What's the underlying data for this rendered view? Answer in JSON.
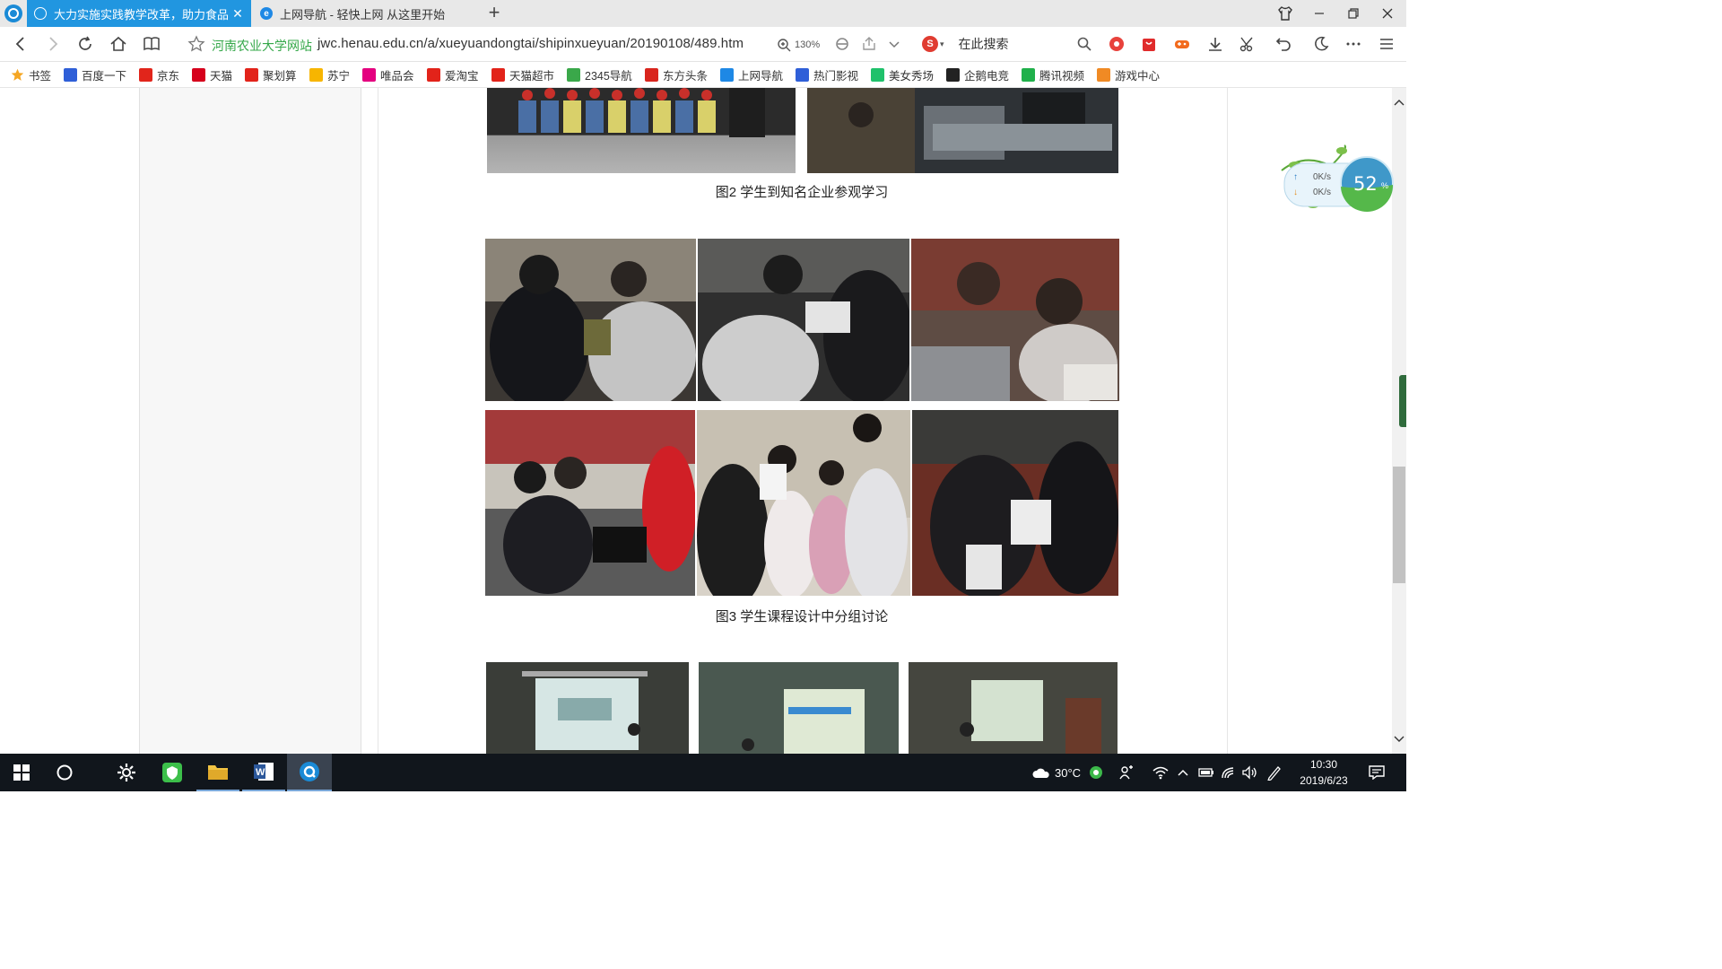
{
  "tabs": [
    {
      "title": "大力实施实践教学改革，助力食品新",
      "active": true
    },
    {
      "title": "上网导航 - 轻快上网 从这里开始",
      "active": false
    }
  ],
  "navbar": {
    "site_name": "河南农业大学网站",
    "url": "jwc.henau.edu.cn/a/xueyuandongtai/shipinxueyuan/20190108/489.htm",
    "zoom": "130%",
    "search_placeholder": "在此搜索"
  },
  "bookmarks": [
    {
      "label": "书签",
      "icon": "star-icon",
      "color": "#f5a623"
    },
    {
      "label": "百度一下",
      "icon": "baidu-paw-icon",
      "color": "#2f5fd8"
    },
    {
      "label": "京东",
      "icon": "jd-icon",
      "color": "#e1251b"
    },
    {
      "label": "天猫",
      "icon": "tmall-icon",
      "color": "#d6001c"
    },
    {
      "label": "聚划算",
      "icon": "juhuasuan-icon",
      "color": "#e2231a"
    },
    {
      "label": "苏宁",
      "icon": "suning-icon",
      "color": "#f7b500"
    },
    {
      "label": "唯品会",
      "icon": "vip-icon",
      "color": "#e4007f"
    },
    {
      "label": "爱淘宝",
      "icon": "taobao-icon",
      "color": "#e2231a"
    },
    {
      "label": "天猫超市",
      "icon": "taobao-icon",
      "color": "#e2231a"
    },
    {
      "label": "2345导航",
      "icon": "2345-icon",
      "color": "#3aa84a"
    },
    {
      "label": "东方头条",
      "icon": "toutiao-icon",
      "color": "#d9251d"
    },
    {
      "label": "上网导航",
      "icon": "ie-icon",
      "color": "#1e88e5"
    },
    {
      "label": "热门影视",
      "icon": "video-paw-icon",
      "color": "#2f5fd8"
    },
    {
      "label": "美女秀场",
      "icon": "show-icon",
      "color": "#1fc16b"
    },
    {
      "label": "企鹅电竞",
      "icon": "penguin-icon",
      "color": "#222222"
    },
    {
      "label": "腾讯视频",
      "icon": "tencent-video-icon",
      "color": "#20b04b"
    },
    {
      "label": "游戏中心",
      "icon": "gamepad-icon",
      "color": "#f08a24"
    }
  ],
  "article": {
    "captions": [
      "图2  学生到知名企业参观学习",
      "图3  学生课程设计中分组讨论"
    ]
  },
  "speed_widget": {
    "upload": "0K/s",
    "download": "0K/s",
    "percent": "52",
    "percent_suffix": "%"
  },
  "taskbar": {
    "weather": "30°C",
    "time": "10:30",
    "date": "2019/6/23"
  },
  "colors": {
    "tab_active": "#2196e0",
    "site_name": "#35a84a",
    "taskbar": "#11161c"
  }
}
